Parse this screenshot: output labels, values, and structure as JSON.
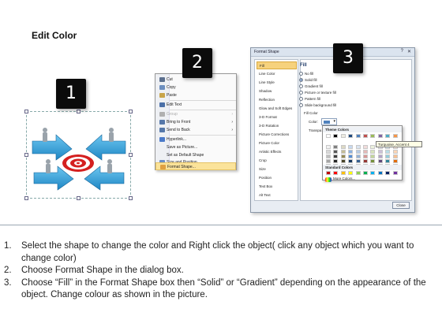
{
  "title": "Edit Color",
  "steps": {
    "badge1": "1",
    "badge2": "2",
    "badge3": "3"
  },
  "context_menu": {
    "items": [
      {
        "label": "Cut",
        "icon": "scissors-icon",
        "color": "#5b6f8e"
      },
      {
        "label": "Copy",
        "icon": "copy-icon",
        "color": "#6c8ec0"
      },
      {
        "label": "Paste",
        "icon": "paste-icon",
        "color": "#c8a44a"
      },
      {
        "label": "Edit Text",
        "icon": "edit-text-icon",
        "color": "#4a6fa8"
      },
      {
        "label": "Group",
        "icon": "group-icon",
        "color": "#b0b0b0"
      },
      {
        "label": "Bring to Front",
        "icon": "bring-front-icon",
        "color": "#5577aa"
      },
      {
        "label": "Send to Back",
        "icon": "send-back-icon",
        "color": "#5577aa"
      },
      {
        "label": "Hyperlink...",
        "icon": "hyperlink-icon",
        "color": "#4a79c9"
      },
      {
        "label": "Save as Picture...",
        "icon": "",
        "color": ""
      },
      {
        "label": "Set as Default Shape",
        "icon": "",
        "color": ""
      },
      {
        "label": "Size and Position...",
        "icon": "size-position-icon",
        "color": "#6a8fc8"
      },
      {
        "label": "Format Shape...",
        "icon": "format-shape-icon",
        "color": "#e0a040"
      }
    ]
  },
  "dialog": {
    "title": "Format Shape",
    "nav": [
      "Fill",
      "Line Color",
      "Line Style",
      "Shadow",
      "Reflection",
      "Glow and Soft Edges",
      "3-D Format",
      "3-D Rotation",
      "Picture Corrections",
      "Picture Color",
      "Artistic Effects",
      "Crop",
      "Size",
      "Position",
      "Text Box",
      "Alt Text"
    ],
    "fill_heading": "Fill",
    "options": [
      "No fill",
      "Solid fill",
      "Gradient fill",
      "Picture or texture fill",
      "Pattern fill",
      "Slide background fill"
    ],
    "fill_color_heading": "Fill Color",
    "color_label": "Color:",
    "transparency_label": "Transpa",
    "close_label": "Close",
    "accent": "#4f81bd"
  },
  "picker": {
    "theme_heading": "Theme Colors",
    "standard_heading": "Standard Colors",
    "more_label": "More Colors...",
    "tooltip": "Turquoise, Accent 4",
    "theme_top": [
      "#ffffff",
      "#000000",
      "#eeece1",
      "#1f497d",
      "#4f81bd",
      "#c0504d",
      "#9bbb59",
      "#8064a2",
      "#4bacc6",
      "#f79646"
    ],
    "theme_shades": [
      [
        "#f2f2f2",
        "#7f7f7f",
        "#ddd9c3",
        "#c6d9f0",
        "#dbe5f1",
        "#f2dcdb",
        "#ebf1dd",
        "#e5e0ec",
        "#dbeef3",
        "#fdeada"
      ],
      [
        "#d8d8d8",
        "#595959",
        "#c4bd97",
        "#8db3e2",
        "#b8cce4",
        "#e5b9b7",
        "#d7e3bc",
        "#ccc1d9",
        "#b7dde8",
        "#fbd5b5"
      ],
      [
        "#bfbfbf",
        "#3f3f3f",
        "#938953",
        "#548dd4",
        "#95b3d7",
        "#d99694",
        "#c3d69b",
        "#b2a2c7",
        "#92cddc",
        "#fac08f"
      ],
      [
        "#a5a5a5",
        "#262626",
        "#494429",
        "#17365d",
        "#366092",
        "#953734",
        "#76923c",
        "#5f497a",
        "#31859b",
        "#e36c09"
      ],
      [
        "#7f7f7f",
        "#0c0c0c",
        "#1d1b10",
        "#0f243e",
        "#244061",
        "#632423",
        "#4f6128",
        "#3f3151",
        "#205867",
        "#974806"
      ]
    ],
    "standard": [
      "#c00000",
      "#ff0000",
      "#ffc000",
      "#ffff00",
      "#92d050",
      "#00b050",
      "#00b0f0",
      "#0070c0",
      "#002060",
      "#7030a0"
    ]
  },
  "graphic": {
    "arrow_color": "#3aa6dc",
    "target_color": "#d42020",
    "person_color": "#9aa3ab"
  },
  "instructions": [
    {
      "num": "1.",
      "text": "Select the shape to change the color and Right click the object( click any object which you want to change color)"
    },
    {
      "num": "2.",
      "text": "Choose Format Shape in the dialog box."
    },
    {
      "num": "3.",
      "text": "Choose “Fill” in the Format Shape box then “Solid” or “Gradient” depending on the appearance of the object. Change colour as shown in the picture."
    }
  ]
}
